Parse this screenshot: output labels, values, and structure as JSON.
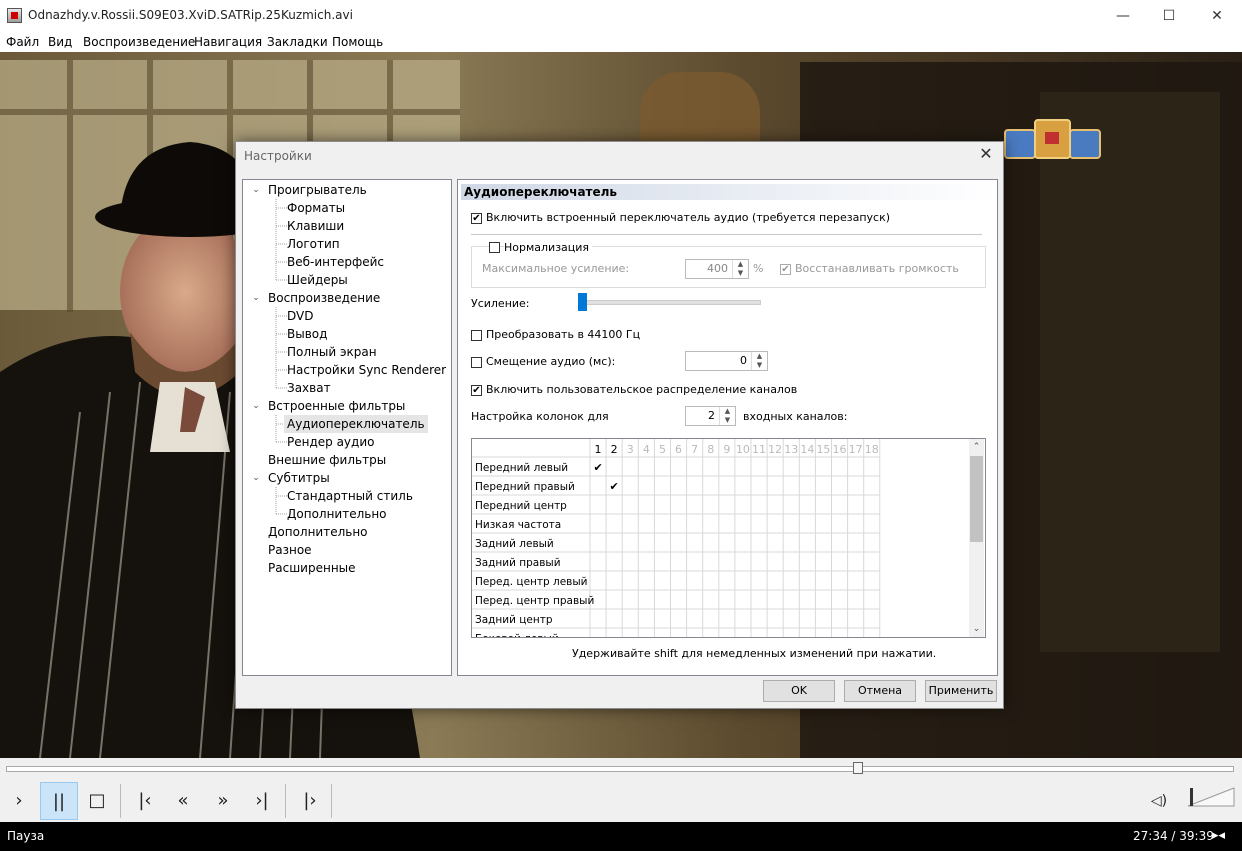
{
  "window": {
    "title": "Odnazhdy.v.Rossii.S09E03.XviD.SATRip.25Kuzmich.avi",
    "minimize": "—",
    "maximize": "☐",
    "close": "✕"
  },
  "menu": [
    "Файл",
    "Вид",
    "Воспроизведение",
    "Навигация",
    "Закладки",
    "Помощь"
  ],
  "dialog": {
    "title": "Настройки",
    "tree": [
      {
        "label": "Проигрыватель",
        "level": 0,
        "expanded": true
      },
      {
        "label": "Форматы",
        "level": 1
      },
      {
        "label": "Клавиши",
        "level": 1
      },
      {
        "label": "Логотип",
        "level": 1
      },
      {
        "label": "Веб-интерфейс",
        "level": 1
      },
      {
        "label": "Шейдеры",
        "level": 1
      },
      {
        "label": "Воспроизведение",
        "level": 0,
        "expanded": true
      },
      {
        "label": "DVD",
        "level": 1
      },
      {
        "label": "Вывод",
        "level": 1
      },
      {
        "label": "Полный экран",
        "level": 1
      },
      {
        "label": "Настройки Sync Renderer",
        "level": 1
      },
      {
        "label": "Захват",
        "level": 1
      },
      {
        "label": "Встроенные фильтры",
        "level": 0,
        "expanded": true
      },
      {
        "label": "Аудиопереключатель",
        "level": 1,
        "selected": true
      },
      {
        "label": "Рендер аудио",
        "level": 1
      },
      {
        "label": "Внешние фильтры",
        "level": 0
      },
      {
        "label": "Субтитры",
        "level": 0,
        "expanded": true
      },
      {
        "label": "Стандартный стиль",
        "level": 1
      },
      {
        "label": "Дополнительно",
        "level": 1
      },
      {
        "label": "Дополнительно",
        "level": 0
      },
      {
        "label": "Разное",
        "level": 0
      },
      {
        "label": "Расширенные",
        "level": 0
      }
    ],
    "panel": {
      "title": "Аудиопереключатель",
      "enable_switcher": {
        "label": "Включить встроенный переключатель аудио (требуется перезапуск)",
        "checked": true
      },
      "normalization": {
        "label": "Нормализация",
        "checked": false
      },
      "max_gain": {
        "label": "Максимальное усиление:",
        "value": "400",
        "unit": "%"
      },
      "restore_volume": {
        "label": "Восстанавливать громкость",
        "checked": true
      },
      "gain": {
        "label": "Усиление:",
        "level": 0
      },
      "convert_44100": {
        "label": "Преобразовать в 44100 Гц",
        "checked": false
      },
      "audio_offset": {
        "label": "Смещение аудио (мс):",
        "value": "0",
        "checked": false
      },
      "custom_channels": {
        "label": "Включить пользовательское распределение каналов",
        "checked": true
      },
      "speaker_config": {
        "label_before": "Настройка колонок для",
        "value": "2",
        "label_after": "входных каналов:"
      },
      "matrix": {
        "columns": [
          "1",
          "2",
          "3",
          "4",
          "5",
          "6",
          "7",
          "8",
          "9",
          "10",
          "11",
          "12",
          "13",
          "14",
          "15",
          "16",
          "17",
          "18"
        ],
        "active_columns": 2,
        "rows": [
          {
            "label": "Передний левый",
            "checked_col": 1
          },
          {
            "label": "Передний правый",
            "checked_col": 2
          },
          {
            "label": "Передний центр",
            "checked_col": 0
          },
          {
            "label": "Низкая частота",
            "checked_col": 0
          },
          {
            "label": "Задний левый",
            "checked_col": 0
          },
          {
            "label": "Задний правый",
            "checked_col": 0
          },
          {
            "label": "Перед. центр левый",
            "checked_col": 0
          },
          {
            "label": "Перед. центр правый",
            "checked_col": 0
          },
          {
            "label": "Задний центр",
            "checked_col": 0
          },
          {
            "label": "Боковой левый",
            "checked_col": 0
          }
        ]
      },
      "hint": "Удерживайте shift для немедленных изменений при нажатии."
    },
    "buttons": {
      "ok": "OK",
      "cancel": "Отмена",
      "apply": "Применить"
    }
  },
  "player": {
    "status": "Пауза",
    "time": "27:34 / 39:39",
    "seek_fraction": 0.695
  },
  "colors": {
    "accent": "#cce4f7",
    "selected_bg": "#e5e5e5",
    "slider_thumb": "#0078d7"
  }
}
